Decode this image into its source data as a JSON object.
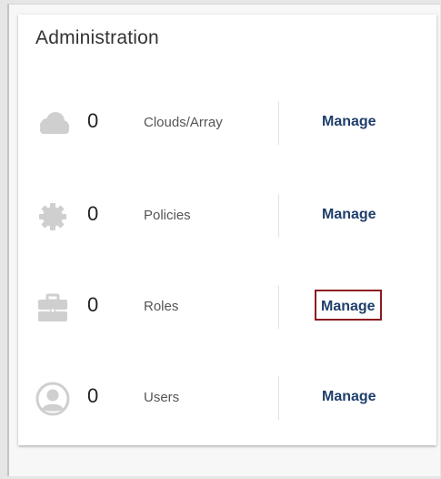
{
  "panel": {
    "title": "Administration"
  },
  "rows": [
    {
      "icon": "cloud-icon",
      "count": "0",
      "label": "Clouds/Array",
      "action": "Manage"
    },
    {
      "icon": "gear-icon",
      "count": "0",
      "label": "Policies",
      "action": "Manage"
    },
    {
      "icon": "briefcase-icon",
      "count": "0",
      "label": "Roles",
      "action": "Manage",
      "highlighted": true
    },
    {
      "icon": "user-icon",
      "count": "0",
      "label": "Users",
      "action": "Manage"
    }
  ],
  "colors": {
    "icon": "#cfcfcf",
    "manage_link": "#1f3f6b",
    "highlight_border": "#8b1a1f"
  }
}
